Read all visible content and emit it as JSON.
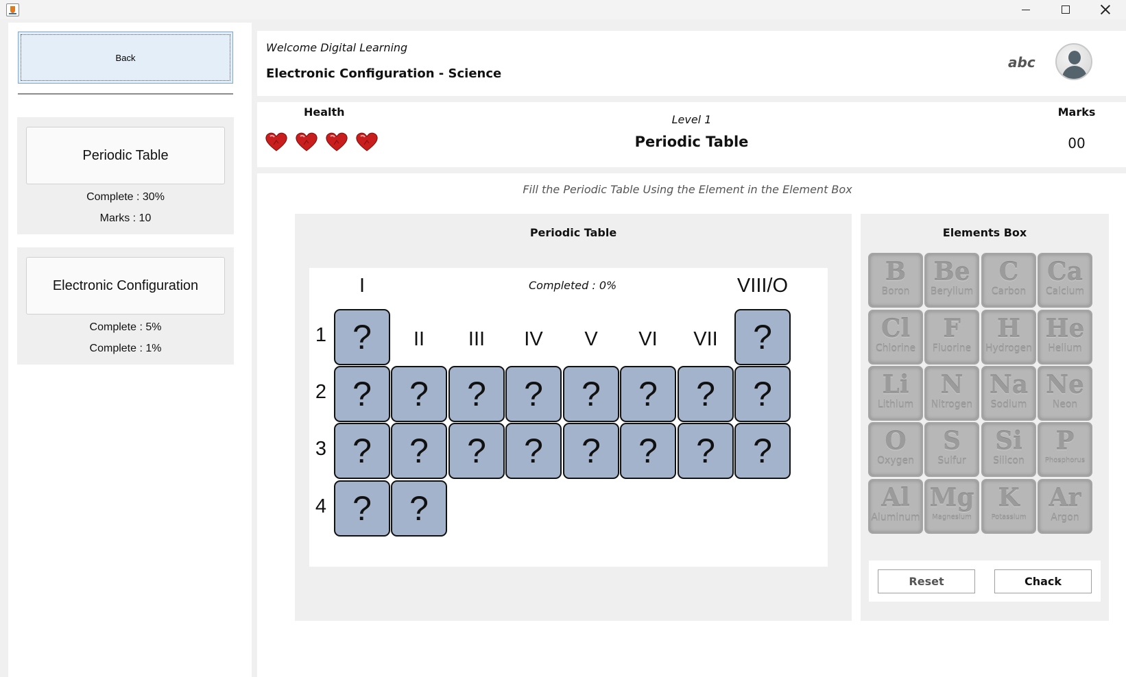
{
  "window": {
    "icon": "java-cup-icon",
    "controls": [
      "minimize-icon",
      "maximize-icon",
      "close-icon"
    ]
  },
  "sidebar": {
    "back_label": "Back",
    "modules": [
      {
        "title": "Periodic Table",
        "line1": "Complete : 30%",
        "line2": "Marks : 10"
      },
      {
        "title": "Electronic Configuration",
        "line1": "Complete : 5%",
        "line2": "Complete : 1%"
      }
    ]
  },
  "header": {
    "welcome": "Welcome Digital Learning",
    "subject": "Electronic Configuration - Science",
    "username": "abc",
    "avatar_icon": "user-avatar-icon"
  },
  "status": {
    "health_label": "Health",
    "hearts": 4,
    "heart_color": "#c81e1e",
    "level": "Level 1",
    "stage_title": "Periodic Table",
    "marks_label": "Marks",
    "marks_value": "00"
  },
  "content": {
    "instruction": "Fill the Periodic Table Using the Element in the Element Box",
    "periodic_table": {
      "title": "Periodic Table",
      "completed": "Completed : 0%",
      "placeholder": "?",
      "groups": [
        "I",
        "II",
        "III",
        "IV",
        "V",
        "VI",
        "VII",
        "VIII/O"
      ],
      "periods": [
        "1",
        "2",
        "3",
        "4"
      ],
      "cell_color": "#a3b3cb"
    },
    "elements_box": {
      "title": "Elements Box",
      "elements": [
        {
          "symbol": "B",
          "name": "Boron"
        },
        {
          "symbol": "Be",
          "name": "Berylium"
        },
        {
          "symbol": "C",
          "name": "Carbon"
        },
        {
          "symbol": "Ca",
          "name": "Calcium"
        },
        {
          "symbol": "Cl",
          "name": "Chlorine"
        },
        {
          "symbol": "F",
          "name": "Fluorine"
        },
        {
          "symbol": "H",
          "name": "Hydrogen"
        },
        {
          "symbol": "He",
          "name": "Helium"
        },
        {
          "symbol": "Li",
          "name": "Lithium"
        },
        {
          "symbol": "N",
          "name": "Nitrogen"
        },
        {
          "symbol": "Na",
          "name": "Sodium"
        },
        {
          "symbol": "Ne",
          "name": "Neon"
        },
        {
          "symbol": "O",
          "name": "Oxygen"
        },
        {
          "symbol": "S",
          "name": "Sulfur"
        },
        {
          "symbol": "Si",
          "name": "Silicon"
        },
        {
          "symbol": "P",
          "name": "Phosphorus"
        },
        {
          "symbol": "Al",
          "name": "Aluminum"
        },
        {
          "symbol": "Mg",
          "name": "Magnesium"
        },
        {
          "symbol": "K",
          "name": "Potassium"
        },
        {
          "symbol": "Ar",
          "name": "Argon"
        }
      ],
      "reset_label": "Reset",
      "check_label": "Chack"
    }
  }
}
